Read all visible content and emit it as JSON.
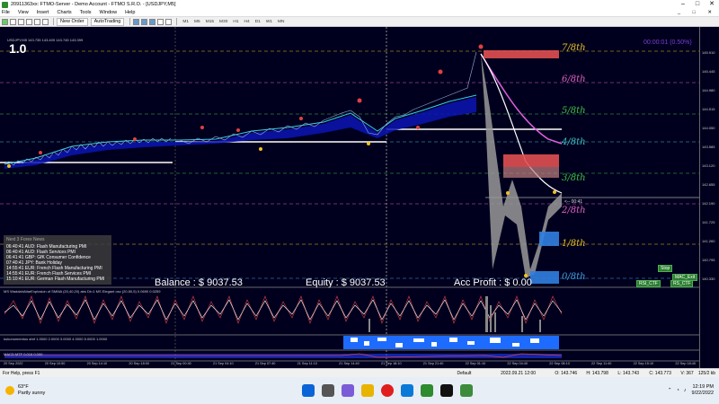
{
  "window": {
    "title": "20911363xx: FTMO-Server - Demo Account - FTMO S.R.O. - [USDJPY,M5]"
  },
  "menu": [
    "File",
    "View",
    "Insert",
    "Charts",
    "Tools",
    "Window",
    "Help"
  ],
  "toolbar": {
    "new_order": "New Order",
    "auto_trading": "AutoTrading",
    "timeframes": [
      "M1",
      "M5",
      "M15",
      "M30",
      "H1",
      "H4",
      "D1",
      "W1",
      "MN"
    ]
  },
  "chart": {
    "big_label": "1.0",
    "symbol_line": "USDJPY,M5  143.735 143.409 143.745 143.399",
    "balance": "Balance : $ 9037.53",
    "equity": "Equity : $ 9037.53",
    "acc_profit": "Acc Profit : $ 0.00",
    "timer": "00:00:01 (0.50%)",
    "countdown": "<-- 00:41",
    "murrey": [
      {
        "label": "7/8th",
        "color": "#e8c020"
      },
      {
        "label": "6/8th",
        "color": "#e060c0"
      },
      {
        "label": "5/8th",
        "color": "#40c040"
      },
      {
        "label": "4/8th",
        "color": "#40c0c0"
      },
      {
        "label": "3/8th",
        "color": "#40c040"
      },
      {
        "label": "2/8th",
        "color": "#e060c0"
      },
      {
        "label": "1/8th",
        "color": "#e8c020"
      },
      {
        "label": "0/8th",
        "color": "#40a0e0"
      }
    ],
    "price_ticks": [
      "145.910",
      "145.445",
      "144.980",
      "144.515",
      "144.050",
      "143.585",
      "143.120",
      "142.655",
      "142.190",
      "141.725",
      "141.260",
      "140.795",
      "140.330"
    ],
    "news": {
      "header": "Next 3 Forex News",
      "rows": [
        "06:40:41  AUD: Flash Manufacturing PMI",
        "06:40:41  AUD: Flash Services PMI",
        "06:41:41  GBP: GfK Consumer Confidence",
        "07:40:41  JPY: Bank Holiday",
        "14:55:41  EUR: French Flash Manufacturing PMI",
        "14:55:41  EUR: French Flash Services PMI",
        "15:10:41  EUR: German Flash Manufacturing PMI"
      ]
    },
    "sub1_label": "MS  WaddahAttarExplosion of SMMA (20,40,20)  abs Dt=1 MS Elegant osc (20,50,5)  0.0690  0.0259",
    "sub2_label": "kukumomentus  ahrf  1.0000  2.0000  3.0000  4.0000  5.0000  1.0000",
    "sub3_label": "MACD MTF  0.016  0.000",
    "buttons": [
      "Stop",
      "MAC_Exit",
      "RSI_CTF",
      "RS_CTF"
    ],
    "time_labels": [
      "20 Sep 2022",
      "20 Sep 10:50",
      "20 Sep 14:10",
      "20 Sep 18:00",
      "21 Sep 00:40",
      "21 Sep 04:10",
      "21 Sep 07:40",
      "21 Sep 11:10",
      "21 Sep 14:40",
      "21 Sep 18:10",
      "21 Sep 21:40",
      "22 Sep 01:10",
      "22 Sep 04:40",
      "22 Sep 08:10",
      "22 Sep 11:40",
      "22 Sep 15:10",
      "22 Sep 18:40"
    ]
  },
  "status": {
    "help": "For Help, press F1",
    "profile": "Default",
    "datetime": "2022.09.21 12:00",
    "o": "O: 143.746",
    "h": "H: 143.798",
    "l": "L: 143.743",
    "c": "C: 143.773",
    "v": "V: 367",
    "kb": "125/2 kb"
  },
  "taskbar": {
    "temp": "63°F",
    "weather": "Partly sunny",
    "time": "12:19 PM",
    "date": "9/22/2022"
  },
  "colors": {
    "chart_bg": "#00001e",
    "titlebar_bg": "#ffffff",
    "status_bg": "#f0f0f0",
    "taskbar_bg": "#e8eef5"
  }
}
